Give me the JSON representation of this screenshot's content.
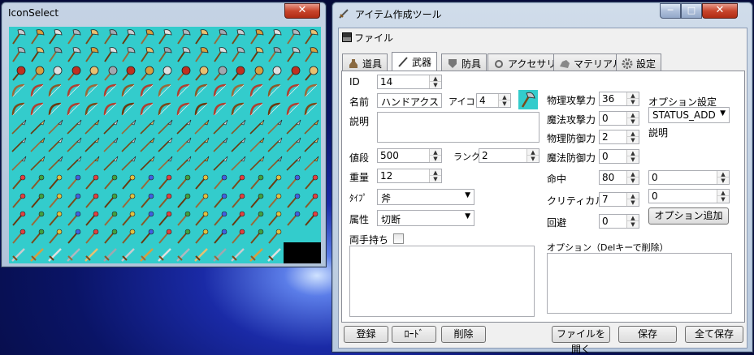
{
  "icon_window": {
    "title": "IconSelect",
    "close_label": "✕"
  },
  "main_window": {
    "title": "アイテム作成ツール",
    "close_label": "✕",
    "minimize_label": "─",
    "maximize_label": "□"
  },
  "menu": {
    "file": "ファイル"
  },
  "tabs": [
    {
      "label": "道具",
      "icon": "potion-icon"
    },
    {
      "label": "武器",
      "icon": "sword-icon"
    },
    {
      "label": "防具",
      "icon": "shield-icon"
    },
    {
      "label": "アクセサリ",
      "icon": "accessory-icon"
    },
    {
      "label": "マテリアル",
      "icon": "material-icon"
    },
    {
      "label": "設定",
      "icon": "gear-icon"
    }
  ],
  "form": {
    "id_label": "ID",
    "id_value": "14",
    "name_label": "名前",
    "name_value": "ハンドアクス",
    "icon_label": "アイコン",
    "icon_value": "4",
    "desc_label": "説明",
    "desc_value": "",
    "price_label": "値段",
    "price_value": "500",
    "rank_label": "ランク",
    "rank_value": "2",
    "weight_label": "重量",
    "weight_value": "12",
    "type_label": "ﾀｲﾌﾟ",
    "type_value": "斧",
    "attr_label": "属性",
    "attr_value": "切断",
    "twohand_label": "両手持ち",
    "phys_atk_label": "物理攻撃力",
    "phys_atk_value": "36",
    "mag_atk_label": "魔法攻撃力",
    "mag_atk_value": "0",
    "phys_def_label": "物理防御力",
    "phys_def_value": "2",
    "mag_def_label": "魔法防御力",
    "mag_def_value": "0",
    "hit_label": "命中",
    "hit_value": "80",
    "hit_extra": "0",
    "crit_label": "クリティカル",
    "crit_value": "7",
    "crit_extra": "0",
    "evade_label": "回避",
    "evade_value": "0",
    "option_setting_label": "オプション設定",
    "option_setting_value": "STATUS_ADD",
    "option_desc_label": "説明",
    "option_add_button": "オプション追加",
    "option_list_label": "オプション（Delキーで削除）"
  },
  "buttons": {
    "register": "登録",
    "load": "ﾛｰﾄﾞ",
    "delete": "削除",
    "open_file": "ファイルを開く",
    "save": "保存",
    "save_all": "全て保存"
  },
  "colors": {
    "grid_bg": "#33cccc",
    "selection": "#000000"
  }
}
